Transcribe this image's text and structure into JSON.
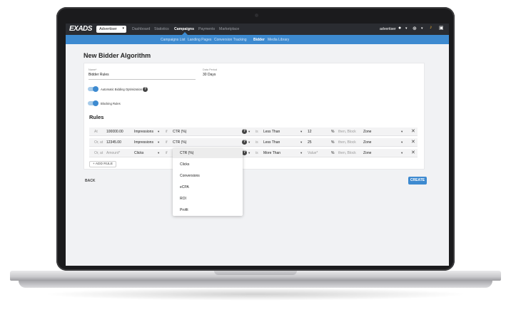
{
  "topbar": {
    "logo": "EXADS",
    "account_select": "Advertiser",
    "nav": [
      "Dashboard",
      "Statistics",
      "Campaigns",
      "Payments",
      "Marketplace"
    ],
    "active_nav": "Campaigns",
    "user": "advertiser"
  },
  "subnav": {
    "items": [
      "Campaigns List",
      "Landing Pages",
      "Conversion Tracking",
      "Bidder",
      "Media Library"
    ],
    "active": "Bidder"
  },
  "page": {
    "title": "New Bidder Algorithm",
    "name_label": "Name*",
    "name_value": "Bidder Rules",
    "period_label": "Data Period",
    "period_value": "30 Days",
    "auto_bidding": "Automatic Bidding Optimization",
    "blocking": "Blocking Rules",
    "rules_heading": "Rules",
    "add_rule": "+ ADD RULE",
    "back": "BACK",
    "create": "CREATE"
  },
  "rules": [
    {
      "prefix": "At",
      "amount": "100000.00",
      "metric": "Impressions",
      "if": "if",
      "cond": "CTR (%)",
      "is": "is",
      "op": "Less Than",
      "val": "12",
      "pct": "%",
      "then": "then, Block",
      "target": "Zone"
    },
    {
      "prefix": "Or, at",
      "amount": "12345.00",
      "metric": "Impressions",
      "if": "if",
      "cond": "CTR (%)",
      "is": "is",
      "op": "Less Than",
      "val": "25",
      "pct": "%",
      "then": "then, Block",
      "target": "Zone"
    },
    {
      "prefix": "Or, at",
      "amount": "Amount*",
      "metric": "Clicks",
      "if": "if",
      "cond": "",
      "is": "is",
      "op": "More Than",
      "val": "Value*",
      "pct": "%",
      "then": "then, Block",
      "target": "Zone"
    }
  ],
  "dropdown_options": [
    "CTR (%)",
    "Clicks",
    "Conversions",
    "eCPA",
    "ROI",
    "Profit"
  ],
  "colors": {
    "accent": "#3d8ad0",
    "topbar": "#2a2c31"
  }
}
